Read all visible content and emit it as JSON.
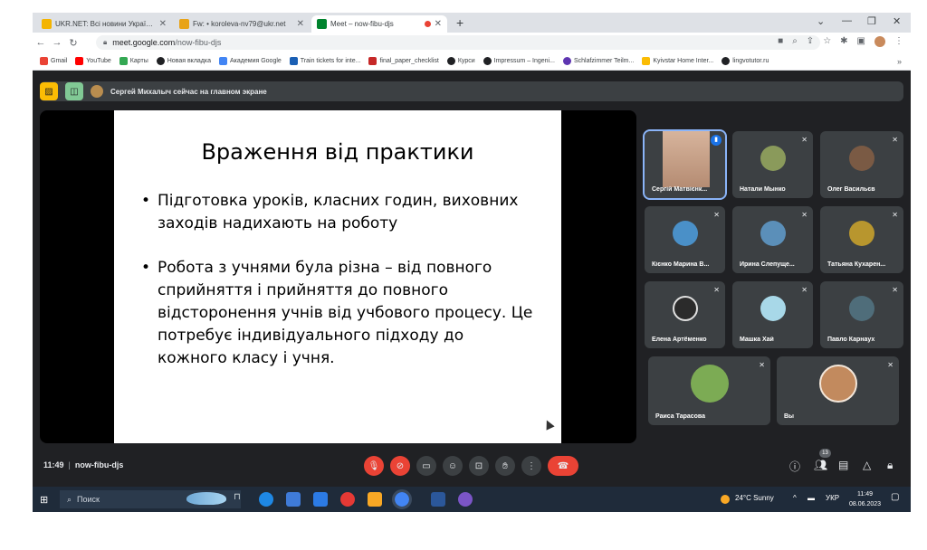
{
  "browser": {
    "tabs": [
      {
        "title": "UKR.NET: Всі новини України, о",
        "color": "#f4b400"
      },
      {
        "title": "Fw: • koroleva-nv79@ukr.net",
        "color": "#e8a317"
      },
      {
        "title": "Meet – now-fibu-djs",
        "color": "#00832d",
        "active": true
      }
    ],
    "url_host": "meet.google.com",
    "url_path": "/now-fibu-djs",
    "bookmarks": [
      {
        "label": "Gmail",
        "color": "#ea4335"
      },
      {
        "label": "YouTube",
        "color": "#ff0000"
      },
      {
        "label": "Карты",
        "color": "#34a853"
      },
      {
        "label": "Новая вкладка",
        "color": "#202124"
      },
      {
        "label": "Академия Google",
        "color": "#4285f4"
      },
      {
        "label": "Train tickets for inte...",
        "color": "#1a5fb4"
      },
      {
        "label": "final_paper_checklist",
        "color": "#c62828"
      },
      {
        "label": "Курси",
        "color": "#202124"
      },
      {
        "label": "Impressum – Ingeni...",
        "color": "#202124"
      },
      {
        "label": "Schlafzimmer Teilm...",
        "color": "#5e35b1"
      },
      {
        "label": "Kyivstar Home Inter...",
        "color": "#fbbc04"
      },
      {
        "label": "lingvotutor.ru",
        "color": "#202124"
      }
    ],
    "bookmarks_more": "»"
  },
  "meet": {
    "presenting_text": "Сергей Михалыч сейчас на главном экране",
    "slide": {
      "title": "Враження від практики",
      "bullets": [
        "Підготовка уроків, класних годин, виховних заходів надихають на роботу",
        "Робота з учнями була різна – від повного сприйняття і прийняття до повного відсторонення учнів від учбового процесу. Це потребує індивідуального підходу до кожного класу і учня."
      ]
    },
    "participants": [
      {
        "name": "Сергій Матвієнк...",
        "speaking": true,
        "avatar_color": "#c9a27e"
      },
      {
        "name": "Натали Мынко",
        "avatar_color": "#8a9a5b"
      },
      {
        "name": "Олег Васильєв",
        "avatar_color": "#7a5a44"
      },
      {
        "name": "Кієнко Марина В...",
        "avatar_color": "#4a90c8"
      },
      {
        "name": "Ирина Слепуще...",
        "avatar_color": "#5b8fb9"
      },
      {
        "name": "Татьяна Кухарен...",
        "avatar_color": "#b8962e"
      },
      {
        "name": "Елена Артёменко",
        "avatar_color": "#2b2b2b"
      },
      {
        "name": "Машка Хай",
        "avatar_color": "#a8d8e8"
      },
      {
        "name": "Павло Карнаух",
        "avatar_color": "#4f6d7a"
      },
      {
        "name": "Раиса Тарасова",
        "avatar_color": "#7cab54"
      },
      {
        "name": "Вы",
        "avatar_color": "#c28a5e"
      }
    ],
    "time": "11:49",
    "meeting_code": "now-fibu-djs",
    "participant_count": "13"
  },
  "taskbar": {
    "search_placeholder": "Поиск",
    "weather": "24°C  Sunny",
    "language": "УКР",
    "time": "11:49",
    "date": "08.06.2023"
  },
  "colors": {
    "meet_bg": "#202124",
    "tile_bg": "#3c4043",
    "danger": "#ea4335",
    "accent_blue": "#8ab4f8"
  }
}
